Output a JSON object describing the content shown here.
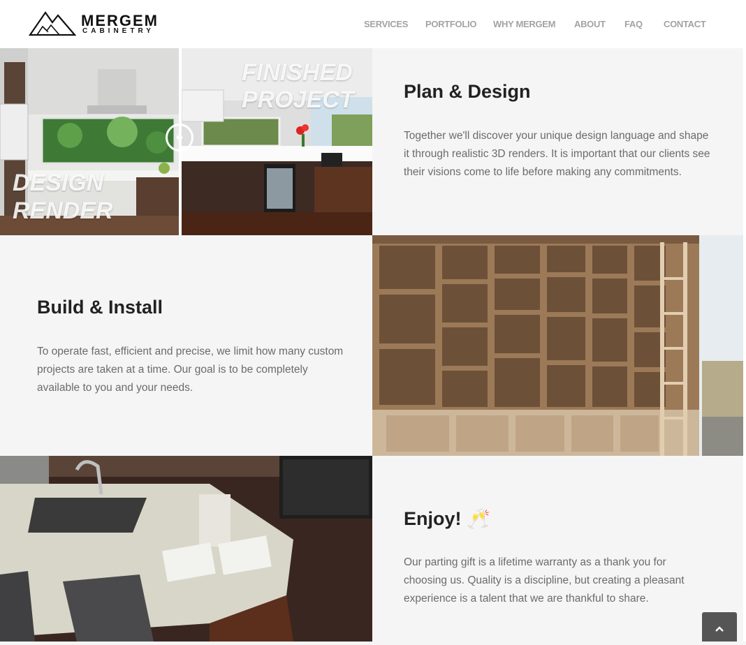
{
  "brand": {
    "name": "MERGEM",
    "sub": "CABINETRY"
  },
  "nav": {
    "items": [
      "SERVICES",
      "PORTFOLIO",
      "WHY MERGEM",
      "ABOUT",
      "FAQ",
      "CONTACT"
    ]
  },
  "plan": {
    "before_label_1": "DESIGN",
    "before_label_2": "RENDER",
    "after_label_1": "FINISHED",
    "after_label_2": "PROJECT",
    "title": "Plan & Design",
    "text": "Together we'll discover your unique design language and shape it through realistic 3D renders. It is important that our clients see their visions come to life before making any commitments."
  },
  "build": {
    "title": "Build & Install",
    "text": "To operate fast, efficient and precise, we limit how many custom projects are taken at a time. Our goal is to be completely available to you and your needs."
  },
  "enjoy": {
    "title": "Enjoy! 🥂",
    "text": "Our parting gift is a lifetime warranty as a thank you for choosing us. Quality is a discipline, but creating a pleasant experience is a talent that we are thankful to share."
  },
  "icons": {
    "compare_handle": "compare-arrows-icon",
    "scroll_top": "chevron-up-icon"
  },
  "colors": {
    "nav_text": "#a3a3a3",
    "heading": "#222222",
    "body_text": "#6b6b6b",
    "panel_bg": "#f5f5f5"
  }
}
